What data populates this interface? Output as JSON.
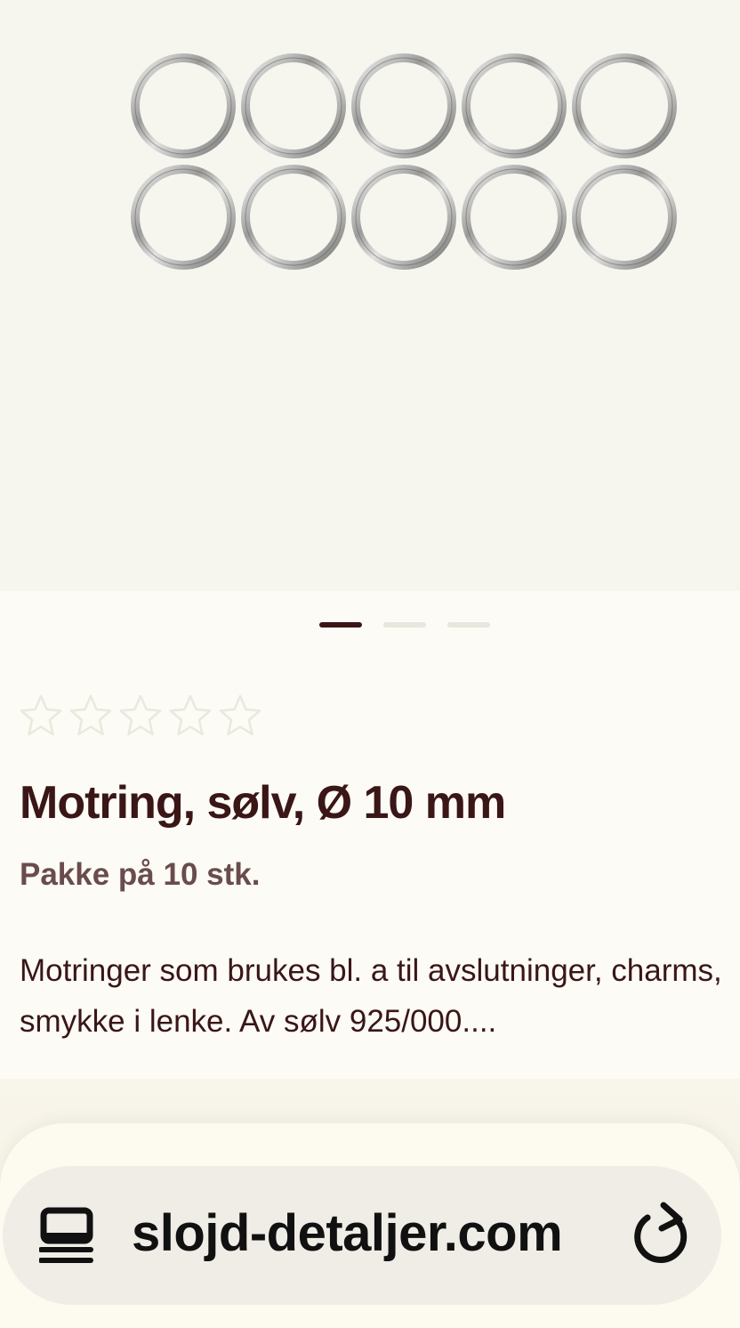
{
  "product_gallery": {
    "image_icon": "silver-jump-rings-icon",
    "slides_total": 3,
    "active_slide": 1
  },
  "rating": {
    "value": 0,
    "max": 5,
    "star_color": "#ebe8dc"
  },
  "product": {
    "title": "Motring, sølv, Ø 10 mm",
    "subtitle": "Pakke på 10 stk.",
    "description": "Motringer som brukes bl. a til avslutninger, charms, smykke i lenke. Av sølv 925/000...."
  },
  "browser": {
    "url": "slojd-detaljer.com",
    "tabs_icon": "tabs-icon",
    "reload_icon": "reload-icon"
  },
  "colors": {
    "text_primary": "#3a1616",
    "text_secondary": "#6a4c4c",
    "hero_bg": "#f7f6ee",
    "page_bg": "#fcfbf6",
    "dot_inactive": "#e9e6dc"
  }
}
